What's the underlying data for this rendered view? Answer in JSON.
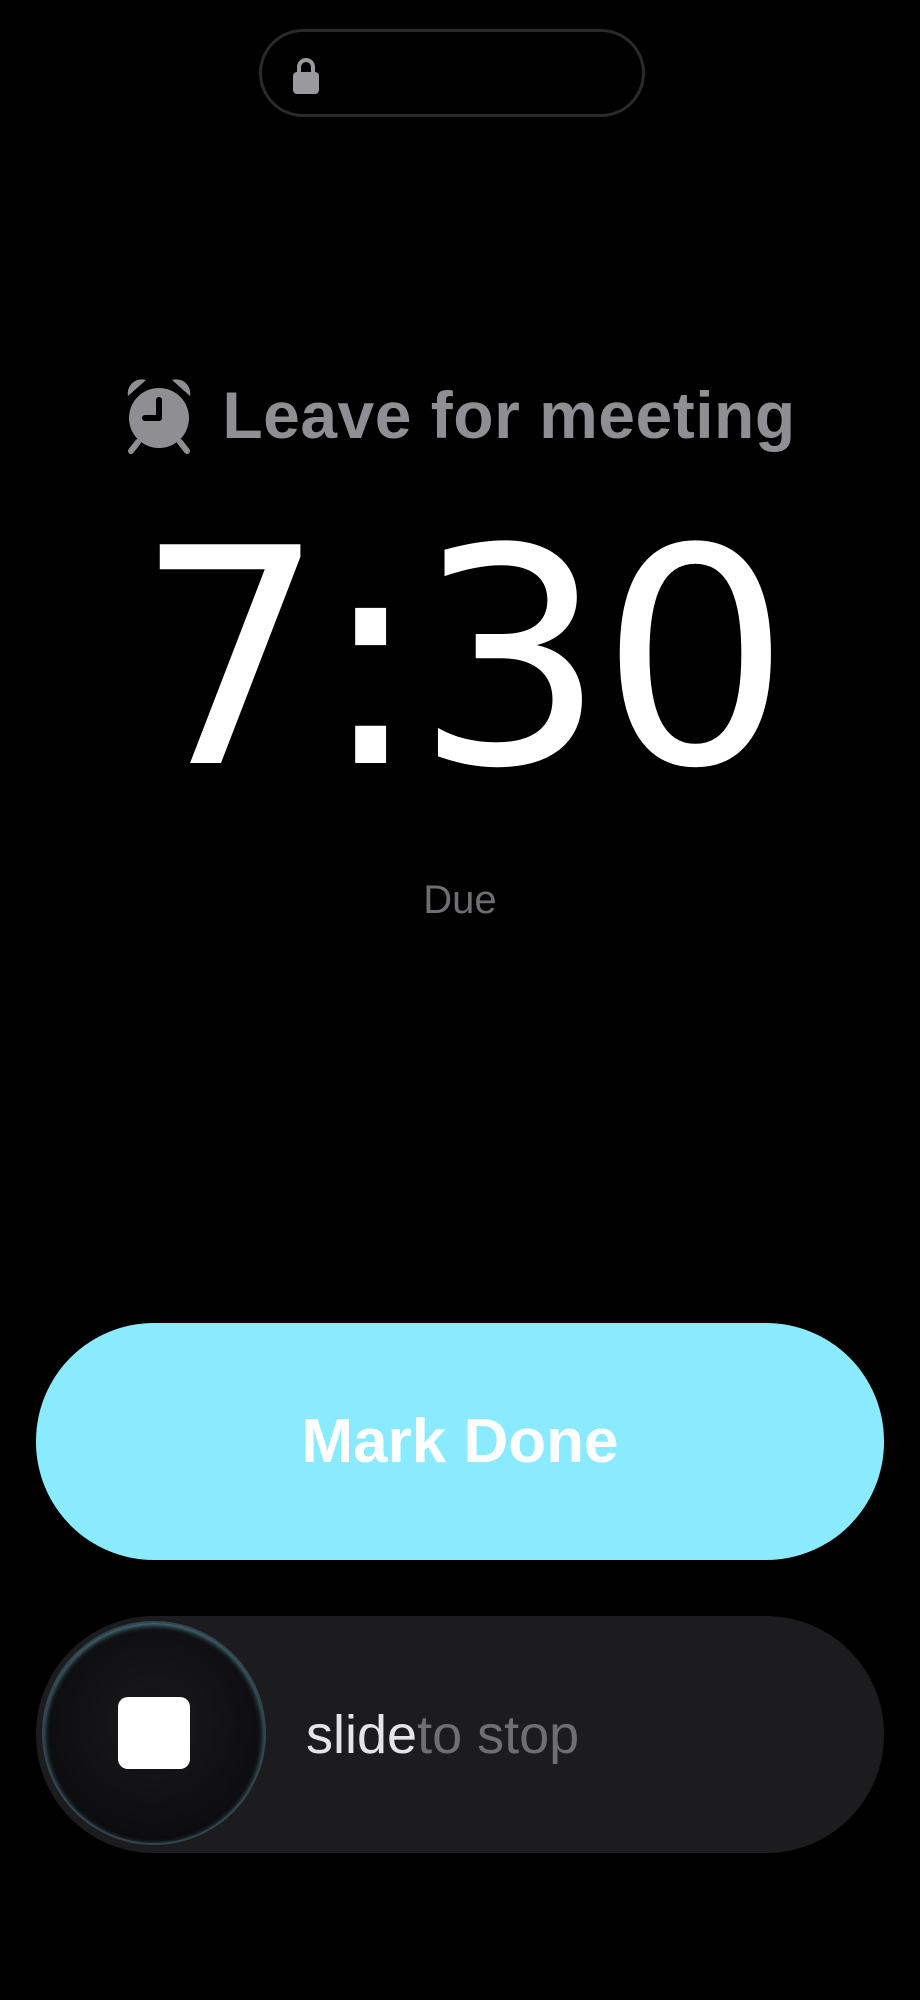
{
  "status_bar": {
    "lock_icon": "lock-icon"
  },
  "alarm": {
    "icon": "alarm-clock-icon",
    "title": "Leave for meeting",
    "time": "7:30",
    "status": "Due"
  },
  "actions": {
    "mark_done_label": "Mark Done",
    "slide_label_lead": "slide",
    "slide_label_rest": " to stop",
    "stop_icon": "stop-icon"
  },
  "colors": {
    "background": "#000000",
    "accent": "#8aeafe",
    "title_gray": "#8e8e93",
    "track": "#1c1c1e"
  }
}
